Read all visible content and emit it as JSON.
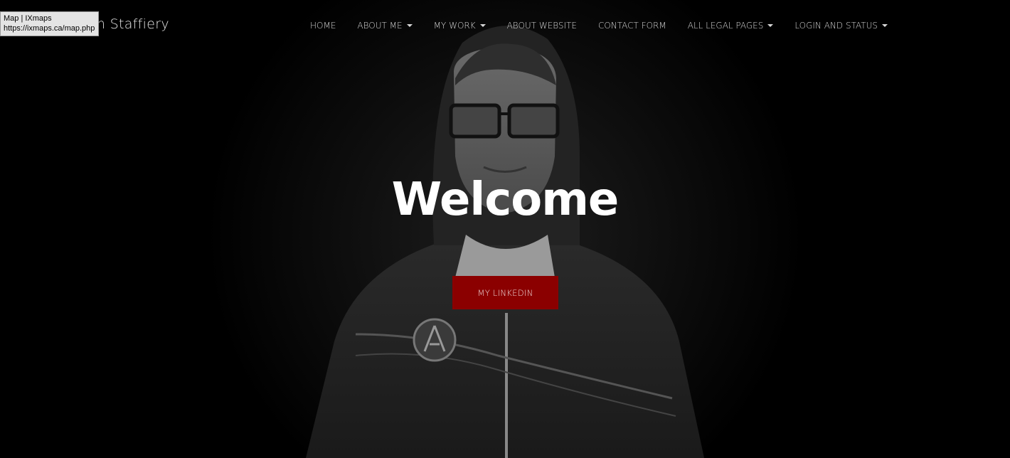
{
  "site": {
    "brand": "ean Staffiery"
  },
  "nav": {
    "items": [
      {
        "label": "HOME",
        "dropdown": false
      },
      {
        "label": "ABOUT ME",
        "dropdown": true
      },
      {
        "label": "MY WORK",
        "dropdown": true
      },
      {
        "label": "ABOUT WEBSITE",
        "dropdown": false
      },
      {
        "label": "CONTACT FORM",
        "dropdown": false
      },
      {
        "label": "ALL LEGAL PAGES",
        "dropdown": true
      },
      {
        "label": "LOGIN AND STATUS",
        "dropdown": true
      }
    ]
  },
  "tooltip": {
    "title": "Map | IXmaps",
    "url": "https://ixmaps.ca/map.php"
  },
  "hero": {
    "heading": "Welcome",
    "cta_label": "MY LINKEDIN"
  },
  "colors": {
    "background": "#000000",
    "cta": "#8b0000",
    "text": "#ffffff"
  },
  "icons": {
    "dropdown": "caret-down-icon",
    "jacket_emblem": "spartan-helmet-icon"
  }
}
